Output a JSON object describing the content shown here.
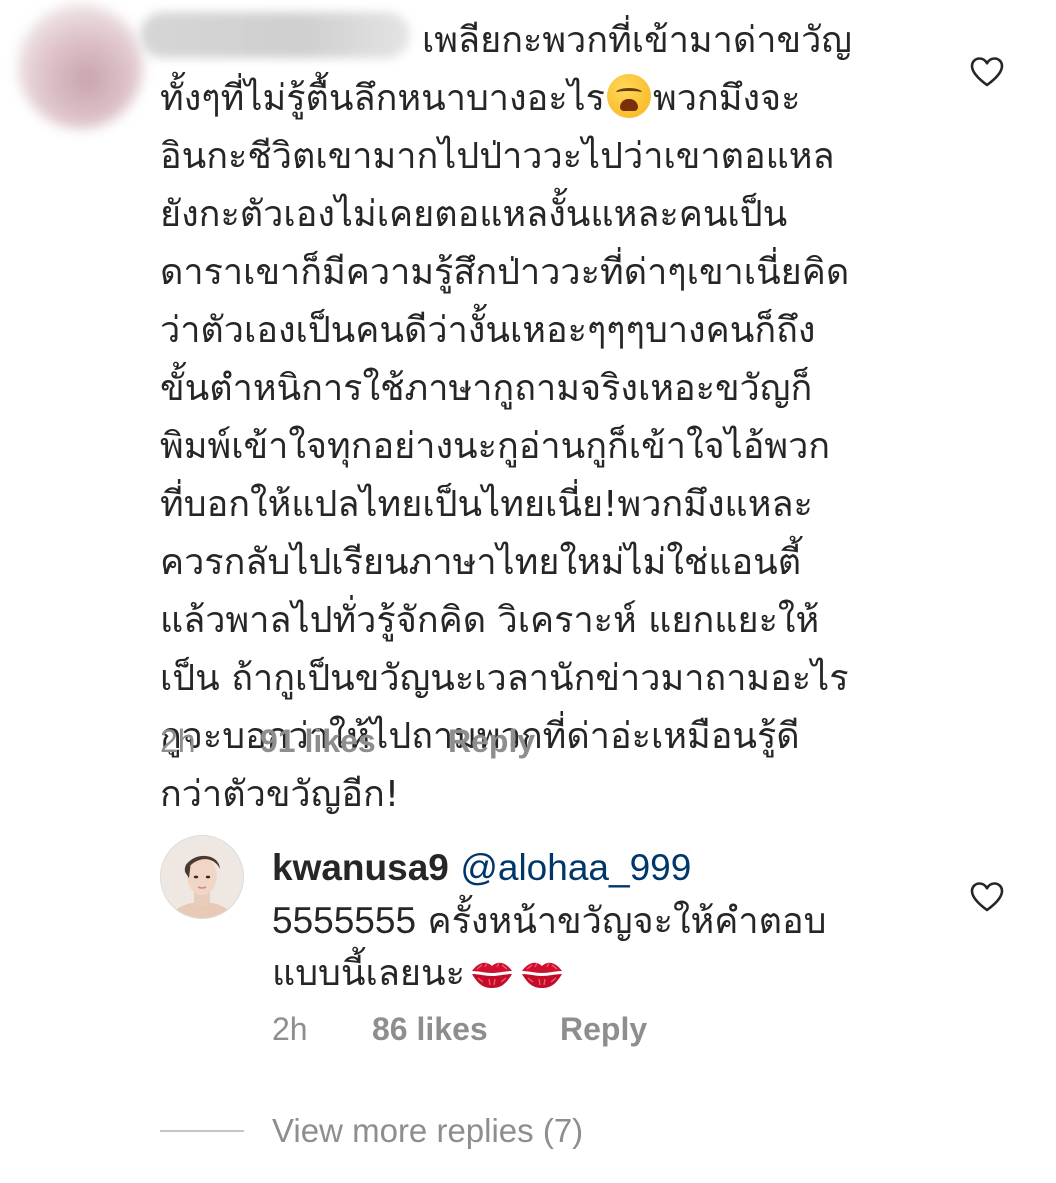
{
  "main_comment": {
    "lines": [
      "เพลียกะพวกที่เข้ามาด่าขวัญ",
      "ทั้งๆที่ไม่รู้ตื้นลึกหนาบางอะไร",
      "พวกมึงจะ",
      "อินกะชีวิตเขามากไปป่าววะไปว่าเขาตอแหล",
      "ยังกะตัวเองไม่เคยตอแหลงั้นแหละคนเป็น",
      "ดาราเขาก็มีความรู้สึกป่าววะที่ด่าๆเขาเนี่ยคิด",
      "ว่าตัวเองเป็นคนดีว่างั้นเหอะๆๆๆบางคนก็ถึง",
      "ขั้นตำหนิการใช้ภาษากูถามจริงเหอะขวัญก็",
      "พิมพ์เข้าใจทุกอย่างนะกูอ่านกูก็เข้าใจไอ้พวก",
      "ที่บอกให้แปลไทยเป็นไทยเนี่ย!พวกมึงแหละ",
      "ควรกลับไปเรียนภาษาไทยใหม่ไม่ใช่แอนตี้",
      "แล้วพาลไปทั่วรู้จักคิด วิเคราะห์ แยกแยะให้",
      "เป็น ถ้ากูเป็นขวัญนะเวลานักข่าวมาถามอะไร",
      "กูจะบอกว่าให้ไปถามพวกที่ด่าอ่ะเหมือนรู้ดี",
      "กว่าตัวขวัญอีก!"
    ],
    "emoji": "weary-face-emoji",
    "time": "2h",
    "likes": "91 likes",
    "reply": "Reply"
  },
  "reply_comment": {
    "username": "kwanusa9",
    "mention": "@alohaa_999",
    "text_number": "5555555",
    "text_rest": " ครั้งหน้าขวัญจะให้คำตอบ",
    "text_line2": "แบบนี้เลยนะ",
    "emoji": "kiss-mark-emoji",
    "time": "2h",
    "likes": "86 likes",
    "reply": "Reply"
  },
  "view_more": "View more replies (7)",
  "icons": {
    "like": "heart-outline-icon"
  },
  "colors": {
    "text": "#262626",
    "meta": "#8e8e8e",
    "mention": "#00376b",
    "divider": "#c7c7c7"
  }
}
